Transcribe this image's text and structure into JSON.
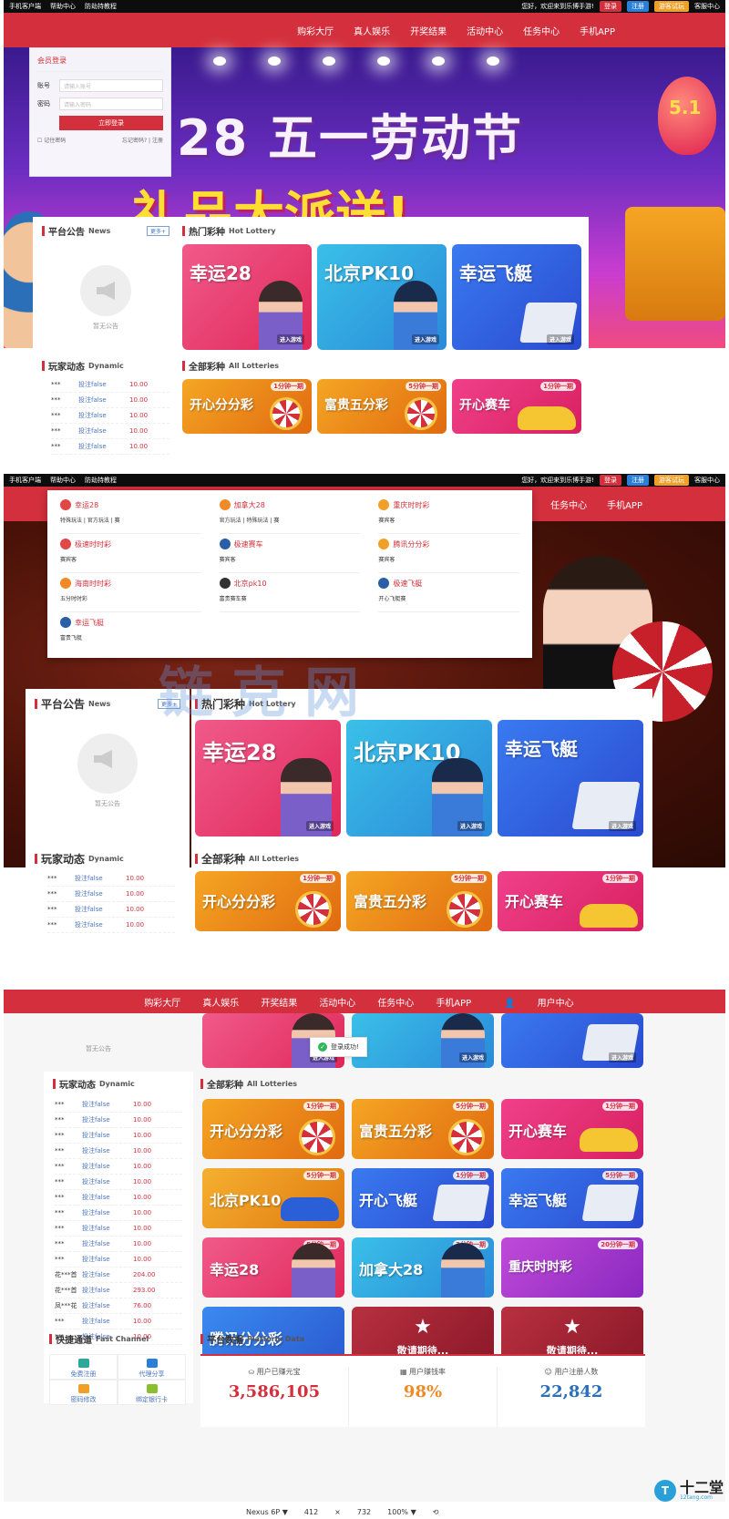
{
  "topbar": {
    "links": [
      "手机客户端",
      "帮助中心",
      "防劫持教程"
    ],
    "welcome": "您好，欢迎来到乐博手游!",
    "login": "登录",
    "register": "注册",
    "trial": "游客试玩",
    "service": "客服中心"
  },
  "nav": [
    "购彩大厅",
    "真人娱乐",
    "开奖结果",
    "活动中心",
    "任务中心",
    "手机APP"
  ],
  "nav_user": "用户中心",
  "banner1": {
    "line1": "28 五一劳动节",
    "line2": "礼品大派送!",
    "balloon": "5.1"
  },
  "login": {
    "title": "会员登录",
    "account_label": "账号",
    "account_placeholder": "请输入账号",
    "password_label": "密码",
    "password_placeholder": "请输入密码",
    "submit": "立即登录",
    "remember": "记住密码",
    "forgot": "忘记密码?",
    "register": "注册"
  },
  "notice": {
    "title": "平台公告",
    "en": "News",
    "more": "更多+",
    "empty": "暂无公告"
  },
  "hot": {
    "title": "热门彩种",
    "en": "Hot Lottery",
    "cards": [
      "幸运28",
      "北京PK10",
      "幸运飞艇"
    ],
    "enter": "进入游戏"
  },
  "dynamic": {
    "title": "玩家动态",
    "en": "Dynamic",
    "rows": [
      {
        "user": "***",
        "action": "投注false",
        "amount": "10.00"
      },
      {
        "user": "***",
        "action": "投注false",
        "amount": "10.00"
      },
      {
        "user": "***",
        "action": "投注false",
        "amount": "10.00"
      },
      {
        "user": "***",
        "action": "投注false",
        "amount": "10.00"
      },
      {
        "user": "***",
        "action": "投注false",
        "amount": "10.00"
      },
      {
        "user": "***",
        "action": "投注false",
        "amount": "10.00"
      },
      {
        "user": "***",
        "action": "投注false",
        "amount": "10.00"
      },
      {
        "user": "***",
        "action": "投注false",
        "amount": "10.00"
      },
      {
        "user": "***",
        "action": "投注false",
        "amount": "10.00"
      },
      {
        "user": "***",
        "action": "投注false",
        "amount": "10.00"
      },
      {
        "user": "***",
        "action": "投注false",
        "amount": "10.00"
      },
      {
        "user": "花***首",
        "action": "投注false",
        "amount": "204.00"
      },
      {
        "user": "花***首",
        "action": "投注false",
        "amount": "293.00"
      },
      {
        "user": "凤***花",
        "action": "投注false",
        "amount": "76.00"
      },
      {
        "user": "***",
        "action": "投注false",
        "amount": "10.00"
      },
      {
        "user": "***",
        "action": "投注false",
        "amount": "10.00"
      }
    ]
  },
  "all": {
    "title": "全部彩种",
    "en": "All Lotteries",
    "cards": [
      {
        "name": "开心分分彩",
        "period": "1分钟一期"
      },
      {
        "name": "富贵五分彩",
        "period": "5分钟一期"
      },
      {
        "name": "开心赛车",
        "period": "1分钟一期"
      },
      {
        "name": "北京PK10",
        "period": "5分钟一期"
      },
      {
        "name": "开心飞艇",
        "period": "1分钟一期"
      },
      {
        "name": "幸运飞艇",
        "period": "5分钟一期"
      },
      {
        "name": "幸运28",
        "period": "5分钟一期"
      },
      {
        "name": "加拿大28",
        "period": "3分钟一期"
      },
      {
        "name": "重庆时时彩",
        "period": "20分钟一期"
      },
      {
        "name": "腾讯分分彩",
        "period": ""
      },
      {
        "name": "敬请期待...",
        "period": ""
      },
      {
        "name": "敬请期待...",
        "period": ""
      }
    ]
  },
  "dropdown": [
    {
      "name": "幸运28",
      "desc": "特殊玩法 | 官方玩法 | 赛",
      "color": "#e04848"
    },
    {
      "name": "加拿大28",
      "desc": "官方玩法 | 特殊玩法 | 赛",
      "color": "#f08a28"
    },
    {
      "name": "重庆时时彩",
      "desc": "赛宾客",
      "color": "#f0a028"
    },
    {
      "name": "极速时时彩",
      "desc": "赛宾客",
      "color": "#e04848"
    },
    {
      "name": "极速赛车",
      "desc": "赛宾客",
      "color": "#2a5fa8"
    },
    {
      "name": "腾讯分分彩",
      "desc": "赛宾客",
      "color": "#f0a028"
    },
    {
      "name": "海南时时彩",
      "desc": "五分时时彩",
      "color": "#f08a28"
    },
    {
      "name": "北京pk10",
      "desc": "富贵赛车赛",
      "color": "#333333"
    },
    {
      "name": "极速飞艇",
      "desc": "开心飞艇赛",
      "color": "#2a5fa8"
    },
    {
      "name": "幸运飞艇",
      "desc": "富贵飞艇",
      "color": "#2a5fa8"
    }
  ],
  "watermark": "链克网",
  "toast": "登录成功!",
  "fast": {
    "title": "快捷通道",
    "en": "Fast Channel",
    "items": [
      "免费注册",
      "代理分享",
      "密码修改",
      "绑定银行卡"
    ]
  },
  "platform": {
    "title": "平台数据",
    "en": "Platform Data",
    "stats": [
      {
        "label": "用户已赚元宝",
        "value": "3,586,105",
        "color": "#d32f3c"
      },
      {
        "label": "用户赚钱率",
        "value": "98%",
        "color": "#f08a28"
      },
      {
        "label": "用户注册人数",
        "value": "22,842",
        "color": "#2a6fb8"
      }
    ]
  },
  "devtools": {
    "device": "Nexus 6P ▼",
    "w": "412",
    "x": "×",
    "h": "732",
    "zoom": "100% ▼"
  },
  "brand": {
    "circle": "T",
    "name": "十二堂",
    "url": "12tang.com"
  }
}
